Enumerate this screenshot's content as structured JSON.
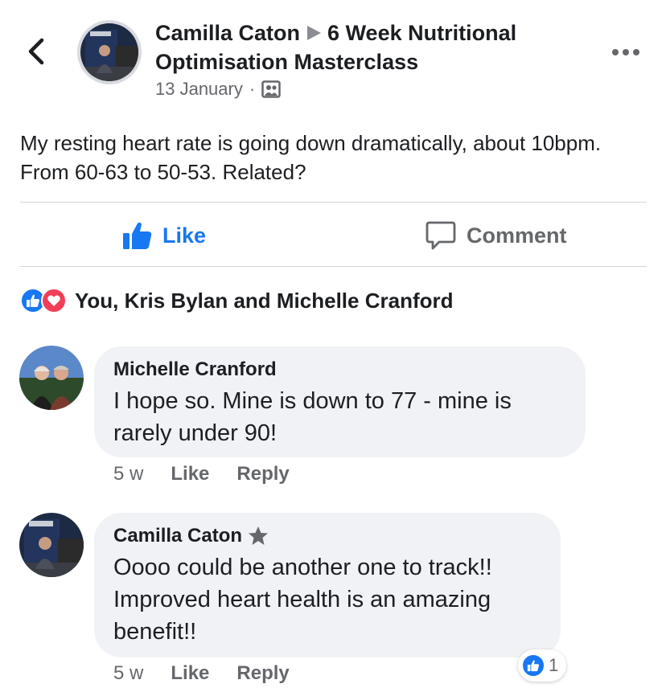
{
  "post": {
    "author": "Camilla Caton",
    "group": "6 Week Nutritional Optimisation Masterclass",
    "date": "13 January",
    "separator": "·",
    "audience_icon": "group-audience-icon",
    "text": "My resting heart rate is going down dramatically, about 10bpm. From 60-63 to 50-53. Related?"
  },
  "actions": {
    "like_label": "Like",
    "comment_label": "Comment"
  },
  "reactions": {
    "summary": "You, Kris Bylan and Michelle Cranford",
    "types": [
      "like",
      "love"
    ]
  },
  "comments": [
    {
      "author": "Michelle Cranford",
      "text": "I hope so.  Mine is down to 77 - mine is rarely under 90!",
      "time": "5 w",
      "like_label": "Like",
      "reply_label": "Reply"
    },
    {
      "author": "Camilla Caton",
      "badge_icon": "top-fan-star-icon",
      "text": "Oooo could be another one to track!! Improved heart health is an amazing benefit!!",
      "time": "5 w",
      "like_label": "Like",
      "reply_label": "Reply",
      "reaction_count": "1"
    }
  ],
  "colors": {
    "accent": "#1877f2",
    "secondary_text": "#65676b",
    "bubble_bg": "#f0f2f5",
    "love": "#f33e58"
  }
}
